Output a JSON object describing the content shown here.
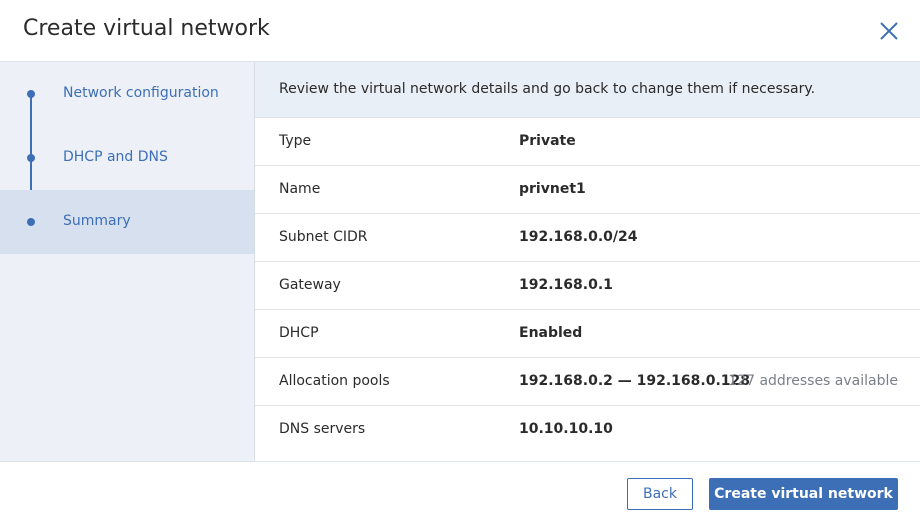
{
  "dialog": {
    "title": "Create virtual network"
  },
  "steps": [
    {
      "label": "Network configuration",
      "active": false
    },
    {
      "label": "DHCP and DNS",
      "active": false
    },
    {
      "label": "Summary",
      "active": true
    }
  ],
  "notice": "Review the virtual network details and go back to change them if necessary.",
  "summary": {
    "rows": [
      {
        "label": "Type",
        "value": "Private",
        "extra": ""
      },
      {
        "label": "Name",
        "value": "privnet1",
        "extra": ""
      },
      {
        "label": "Subnet CIDR",
        "value": "192.168.0.0/24",
        "extra": ""
      },
      {
        "label": "Gateway",
        "value": "192.168.0.1",
        "extra": ""
      },
      {
        "label": "DHCP",
        "value": "Enabled",
        "extra": ""
      },
      {
        "label": "Allocation pools",
        "value": "192.168.0.2 — 192.168.0.128",
        "extra": "127 addresses available"
      },
      {
        "label": "DNS servers",
        "value": "10.10.10.10",
        "extra": ""
      }
    ]
  },
  "footer": {
    "back_label": "Back",
    "create_label": "Create virtual network"
  },
  "colors": {
    "accent": "#3d6fb6",
    "sidebar_bg": "#edf1f7",
    "active_step_bg": "#d7e0ee",
    "notice_bg": "#e9eff7"
  },
  "icons": {
    "close": "close-icon",
    "step_marker": "step-dot-icon"
  }
}
